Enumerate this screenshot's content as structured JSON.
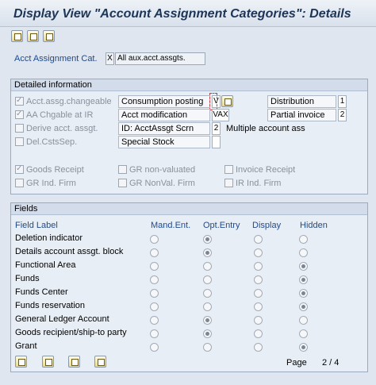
{
  "window": {
    "title": "Display View \"Account Assignment Categories\": Details"
  },
  "toolbar": {
    "icons": [
      "other-entry-icon",
      "previous-entry-icon",
      "next-entry-icon"
    ]
  },
  "key": {
    "label": "Acct Assignment Cat.",
    "value": "X",
    "description": "All aux.acct.assgts."
  },
  "detailed": {
    "title": "Detailed information",
    "checks": [
      {
        "label": "Acct.assg.changeable",
        "checked": true
      },
      {
        "label": "AA Chgable at IR",
        "checked": true
      },
      {
        "label": "Derive acct. assgt.",
        "checked": false
      },
      {
        "label": "Del.CstsSep.",
        "checked": false
      }
    ],
    "consumption_posting": {
      "label": "Consumption posting",
      "value": "V"
    },
    "acct_modification": {
      "label": "Acct modification",
      "value": "VAX"
    },
    "id_screen": {
      "label": "ID: AcctAssgt Scrn",
      "value": "2",
      "text": "Multiple account ass"
    },
    "special_stock": {
      "label": "Special Stock",
      "value": ""
    },
    "distribution": {
      "label": "Distribution",
      "value": "1"
    },
    "partial_invoice": {
      "label": "Partial invoice",
      "value": "2"
    },
    "goods_checks": [
      {
        "label": "Goods Receipt",
        "checked": true
      },
      {
        "label": "GR non-valuated",
        "checked": false
      },
      {
        "label": "Invoice Receipt",
        "checked": false
      },
      {
        "label": "GR Ind. Firm",
        "checked": false
      },
      {
        "label": "GR NonVal. Firm",
        "checked": false
      },
      {
        "label": "IR Ind. Firm",
        "checked": false
      }
    ]
  },
  "fields": {
    "title": "Fields",
    "columns": [
      "Field Label",
      "Mand.Ent.",
      "Opt.Entry",
      "Display",
      "Hidden"
    ],
    "rows": [
      {
        "label": "Deletion indicator",
        "selected": "Opt.Entry"
      },
      {
        "label": "Details account assgt. block",
        "selected": "Opt.Entry"
      },
      {
        "label": "Functional Area",
        "selected": "Hidden"
      },
      {
        "label": "Funds",
        "selected": "Hidden"
      },
      {
        "label": "Funds Center",
        "selected": "Hidden"
      },
      {
        "label": "Funds reservation",
        "selected": "Hidden"
      },
      {
        "label": "General Ledger Account",
        "selected": "Opt.Entry"
      },
      {
        "label": "Goods recipient/ship-to party",
        "selected": "Opt.Entry"
      },
      {
        "label": "Grant",
        "selected": "Hidden"
      }
    ],
    "page_label": "Page",
    "page_value": "2 / 4",
    "nav_icons": [
      "first-page-icon",
      "previous-page-icon",
      "next-page-icon",
      "last-page-icon"
    ]
  }
}
